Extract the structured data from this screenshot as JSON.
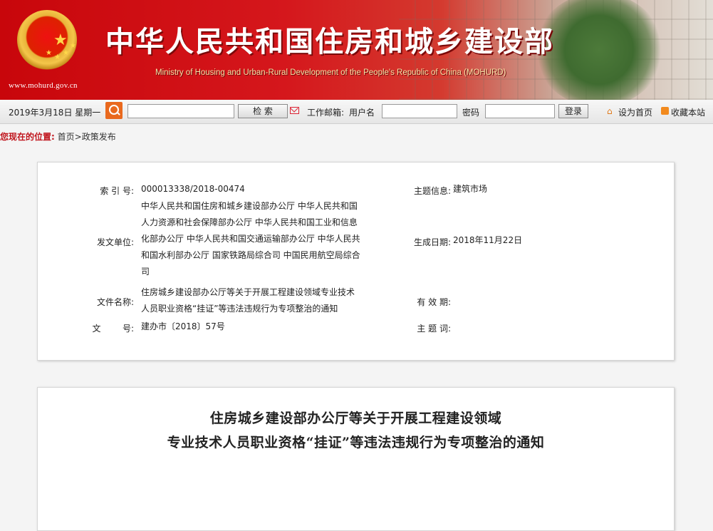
{
  "colors": {
    "banner_red": "#d5171c",
    "label_red": "#c0141c",
    "search_orange": "#e9691e"
  },
  "banner": {
    "site_url": "www.mohurd.gov.cn",
    "title": "中华人民共和国住房和城乡建设部",
    "subtitle": "Ministry of Housing and Urban-Rural Development of the People's Republic of China (MOHURD)",
    "emblem": "national-emblem"
  },
  "toolbar": {
    "date": "2019年3月18日 星期一",
    "search_icon": "search-icon",
    "search_value": "",
    "search_button": "检  索",
    "mail_icon": "mail-icon",
    "mail_label": "工作邮箱:",
    "username_label": "用户名",
    "username_value": "",
    "password_label": "密码",
    "password_value": "",
    "login_button": "登录",
    "home_icon": "home-icon",
    "set_home": "设为首页",
    "rss_icon": "rss-icon",
    "bookmark": "收藏本站"
  },
  "breadcrumb": {
    "label": "您现在的位置:",
    "path": "首页>政策发布"
  },
  "info": {
    "index_label": "索 引 号:",
    "index_value": "000013338/2018-00474",
    "topic_label": "主题信息:",
    "topic_value": "建筑市场",
    "issuer_label": "发文单位:",
    "issuer_lines": [
      "中华人民共和国住房和城乡建设部办公厅 中华人民共和国",
      "人力资源和社会保障部办公厅 中华人民共和国工业和信息",
      "化部办公厅 中华人民共和国交通运输部办公厅 中华人民共",
      "和国水利部办公厅 国家铁路局综合司 中国民用航空局综合",
      "司"
    ],
    "date_label": "生成日期:",
    "date_value": "2018年11月22日",
    "filename_label": "文件名称:",
    "filename_lines": [
      "住房城乡建设部办公厅等关于开展工程建设领域专业技术",
      "人员职业资格“挂证”等违法违规行为专项整治的通知"
    ],
    "validity_label": "有 效 期:",
    "doc_no_label": "文        号:",
    "doc_no_value": "建办市〔2018〕57号",
    "subject_label": "主 题 词:"
  },
  "article": {
    "title_line1": "住房城乡建设部办公厅等关于开展工程建设领域",
    "title_line2": "专业技术人员职业资格“挂证”等违法违规行为专项整治的通知"
  }
}
